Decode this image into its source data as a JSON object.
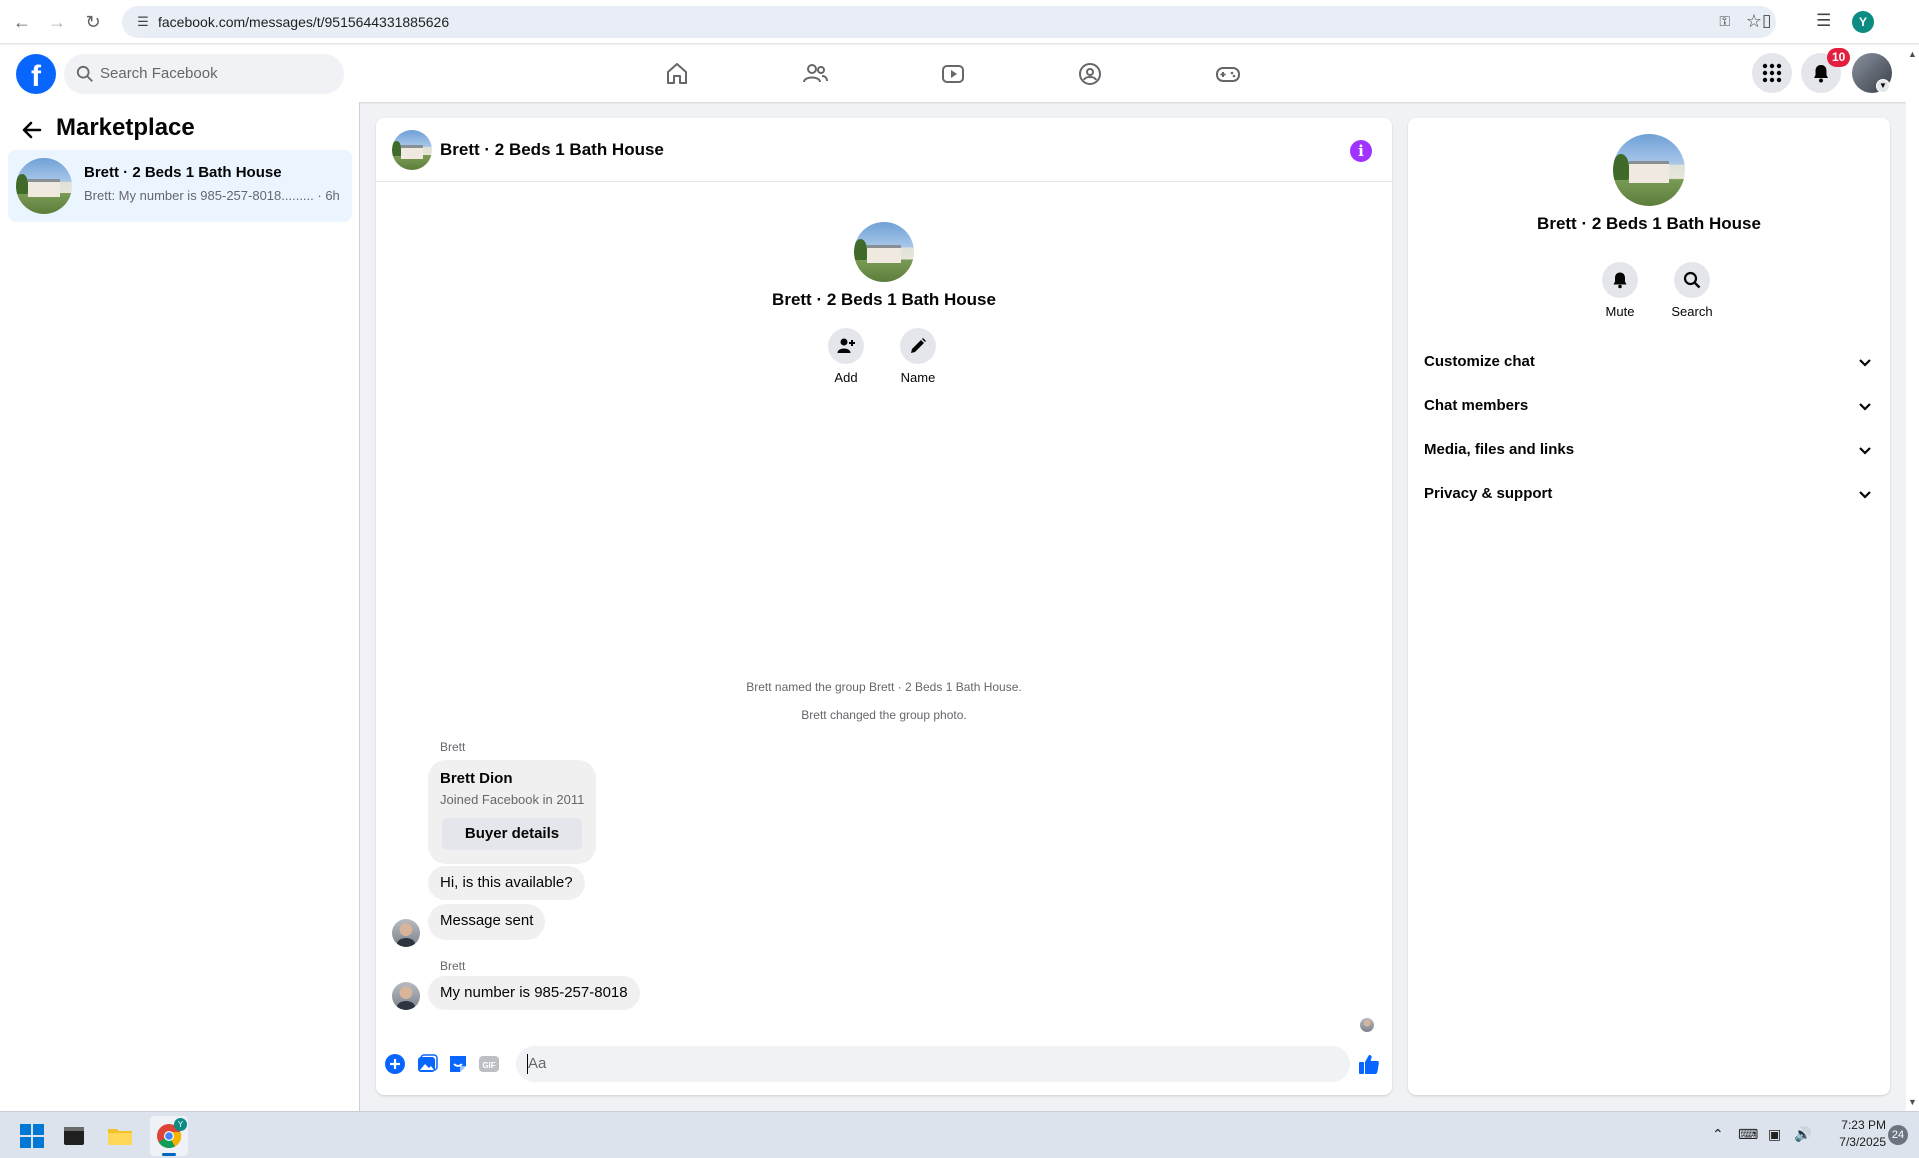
{
  "browser": {
    "url": "facebook.com/messages/t/9515644331885626",
    "profile_initial": "Y"
  },
  "header": {
    "search_placeholder": "Search Facebook",
    "notification_count": "10",
    "nav_icons": [
      "home-icon",
      "friends-icon",
      "video-icon",
      "groups-icon",
      "gaming-icon"
    ]
  },
  "sidebar": {
    "title": "Marketplace",
    "conversations": [
      {
        "name": "Brett · 2 Beds 1 Bath House",
        "snippet": "Brett: My number is 985-257-8018......... · 6h"
      }
    ]
  },
  "chat": {
    "title": "Brett · 2 Beds 1 Bath House",
    "center_name": "Brett · 2 Beds 1 Bath House",
    "actions": [
      {
        "label": "Add",
        "icon": "add-person-icon"
      },
      {
        "label": "Name",
        "icon": "pencil-icon"
      }
    ],
    "system_messages": [
      "Brett named the group Brett · 2 Beds 1 Bath House.",
      "Brett changed the group photo."
    ],
    "sender_label_1": "Brett",
    "card": {
      "name": "Brett Dion",
      "subtitle": "Joined Facebook in 2011",
      "button": "Buyer details"
    },
    "messages": [
      "Hi, is this available?",
      "Message sent"
    ],
    "sender_label_2": "Brett",
    "last_message": "My number is 985-257-8018",
    "composer_placeholder": "Aa"
  },
  "info_panel": {
    "name": "Brett · 2 Beds 1 Bath House",
    "actions": [
      {
        "label": "Mute",
        "icon": "bell-icon"
      },
      {
        "label": "Search",
        "icon": "search-icon"
      }
    ],
    "sections": [
      "Customize chat",
      "Chat members",
      "Media, files and links",
      "Privacy & support"
    ]
  },
  "taskbar": {
    "time": "7:23 PM",
    "date": "7/3/2025",
    "notification_count": "24"
  },
  "colors": {
    "accent": "#0866ff",
    "info": "#a033ff",
    "badge": "#e41e3f",
    "selected": "#ebf5ff"
  }
}
